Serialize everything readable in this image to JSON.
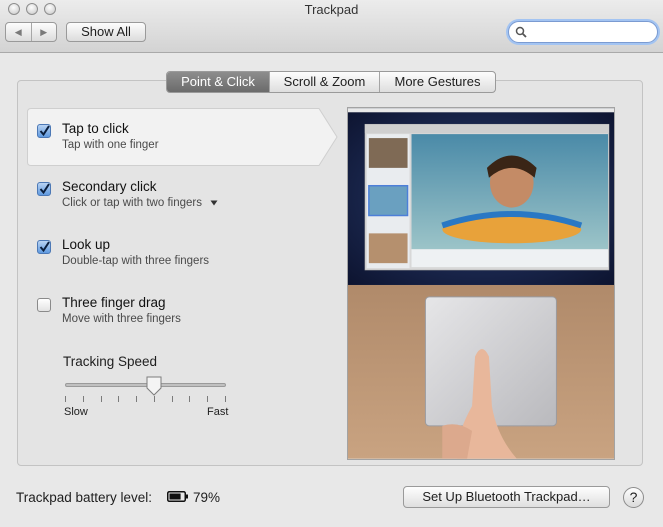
{
  "window": {
    "title": "Trackpad"
  },
  "toolbar": {
    "back_label": "◀",
    "forward_label": "▶",
    "show_all_label": "Show All",
    "search_value": "",
    "search_placeholder": ""
  },
  "tabs": [
    {
      "label": "Point & Click",
      "selected": true
    },
    {
      "label": "Scroll & Zoom",
      "selected": false
    },
    {
      "label": "More Gestures",
      "selected": false
    }
  ],
  "options": [
    {
      "title": "Tap to click",
      "subtitle": "Tap with one finger",
      "checked": true
    },
    {
      "title": "Secondary click",
      "subtitle": "Click or tap with two fingers",
      "checked": true,
      "has_menu": true
    },
    {
      "title": "Look up",
      "subtitle": "Double-tap with three fingers",
      "checked": true
    },
    {
      "title": "Three finger drag",
      "subtitle": "Move with three fingers",
      "checked": false
    }
  ],
  "tracking": {
    "label": "Tracking Speed",
    "min_label": "Slow",
    "max_label": "Fast",
    "value_fraction": 0.55,
    "tick_count": 10
  },
  "footer": {
    "battery_label": "Trackpad battery level:",
    "battery_percent": "79%",
    "bluetooth_button": "Set Up Bluetooth Trackpad…",
    "help": "?"
  },
  "colors": {
    "selected_tab": "#7a7a7a",
    "checkbox_on": "#5f9ae0",
    "search_focus": "#a3c4f2",
    "preview_top": "#1c2a52",
    "preview_bottom": "#a07a5a"
  },
  "icons": {
    "search": "search-icon",
    "battery": "battery-icon",
    "help": "help-icon"
  }
}
